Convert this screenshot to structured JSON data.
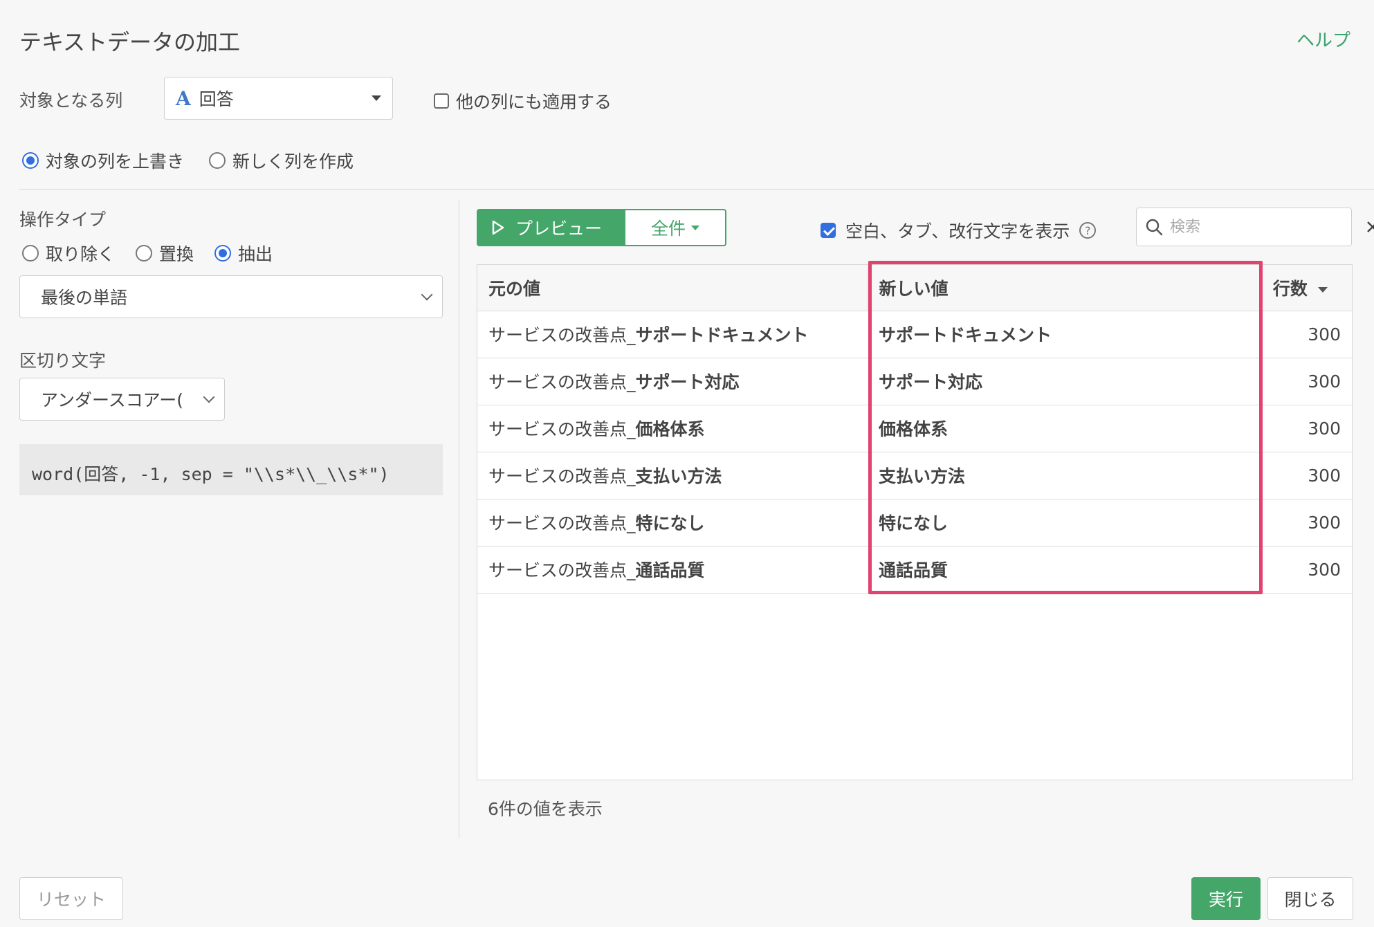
{
  "dialog": {
    "title": "テキストデータの加工",
    "help_label": "ヘルプ"
  },
  "target_column": {
    "label": "対象となる列",
    "type_icon": "A",
    "selected": "回答",
    "apply_other_label": "他の列にも適用する",
    "apply_other_checked": false
  },
  "output_mode": {
    "overwrite_label": "対象の列を上書き",
    "new_column_label": "新しく列を作成",
    "selected": "overwrite"
  },
  "operation": {
    "label": "操作タイプ",
    "options": [
      "取り除く",
      "置換",
      "抽出"
    ],
    "selected": "抽出",
    "method_selected": "最後の単語"
  },
  "delimiter": {
    "label": "区切り文字",
    "selected": "アンダースコアー("
  },
  "expression": "word(回答, -1, sep = \"\\\\s*\\\\_\\\\s*\")",
  "preview": {
    "preview_button": "プレビュー",
    "all_button": "全件",
    "show_whitespace_label": "空白、タブ、改行文字を表示",
    "show_whitespace_checked": true,
    "search_placeholder": "検索"
  },
  "table": {
    "headers": [
      "元の値",
      "新しい値",
      "行数"
    ],
    "rows": [
      {
        "orig_prefix": "サービスの改善点_",
        "orig_suffix": "サポートドキュメント",
        "new": "サポートドキュメント",
        "count": "300"
      },
      {
        "orig_prefix": "サービスの改善点_",
        "orig_suffix": "サポート対応",
        "new": "サポート対応",
        "count": "300"
      },
      {
        "orig_prefix": "サービスの改善点_",
        "orig_suffix": "価格体系",
        "new": "価格体系",
        "count": "300"
      },
      {
        "orig_prefix": "サービスの改善点_",
        "orig_suffix": "支払い方法",
        "new": "支払い方法",
        "count": "300"
      },
      {
        "orig_prefix": "サービスの改善点_",
        "orig_suffix": "特になし",
        "new": "特になし",
        "count": "300"
      },
      {
        "orig_prefix": "サービスの改善点_",
        "orig_suffix": "通話品質",
        "new": "通話品質",
        "count": "300"
      }
    ],
    "footer": "6件の値を表示"
  },
  "buttons": {
    "reset": "リセット",
    "run": "実行",
    "close": "閉じる"
  },
  "colors": {
    "accent_green": "#45a66a",
    "highlight_pink": "#e0436f",
    "radio_blue": "#2f6fe0"
  }
}
